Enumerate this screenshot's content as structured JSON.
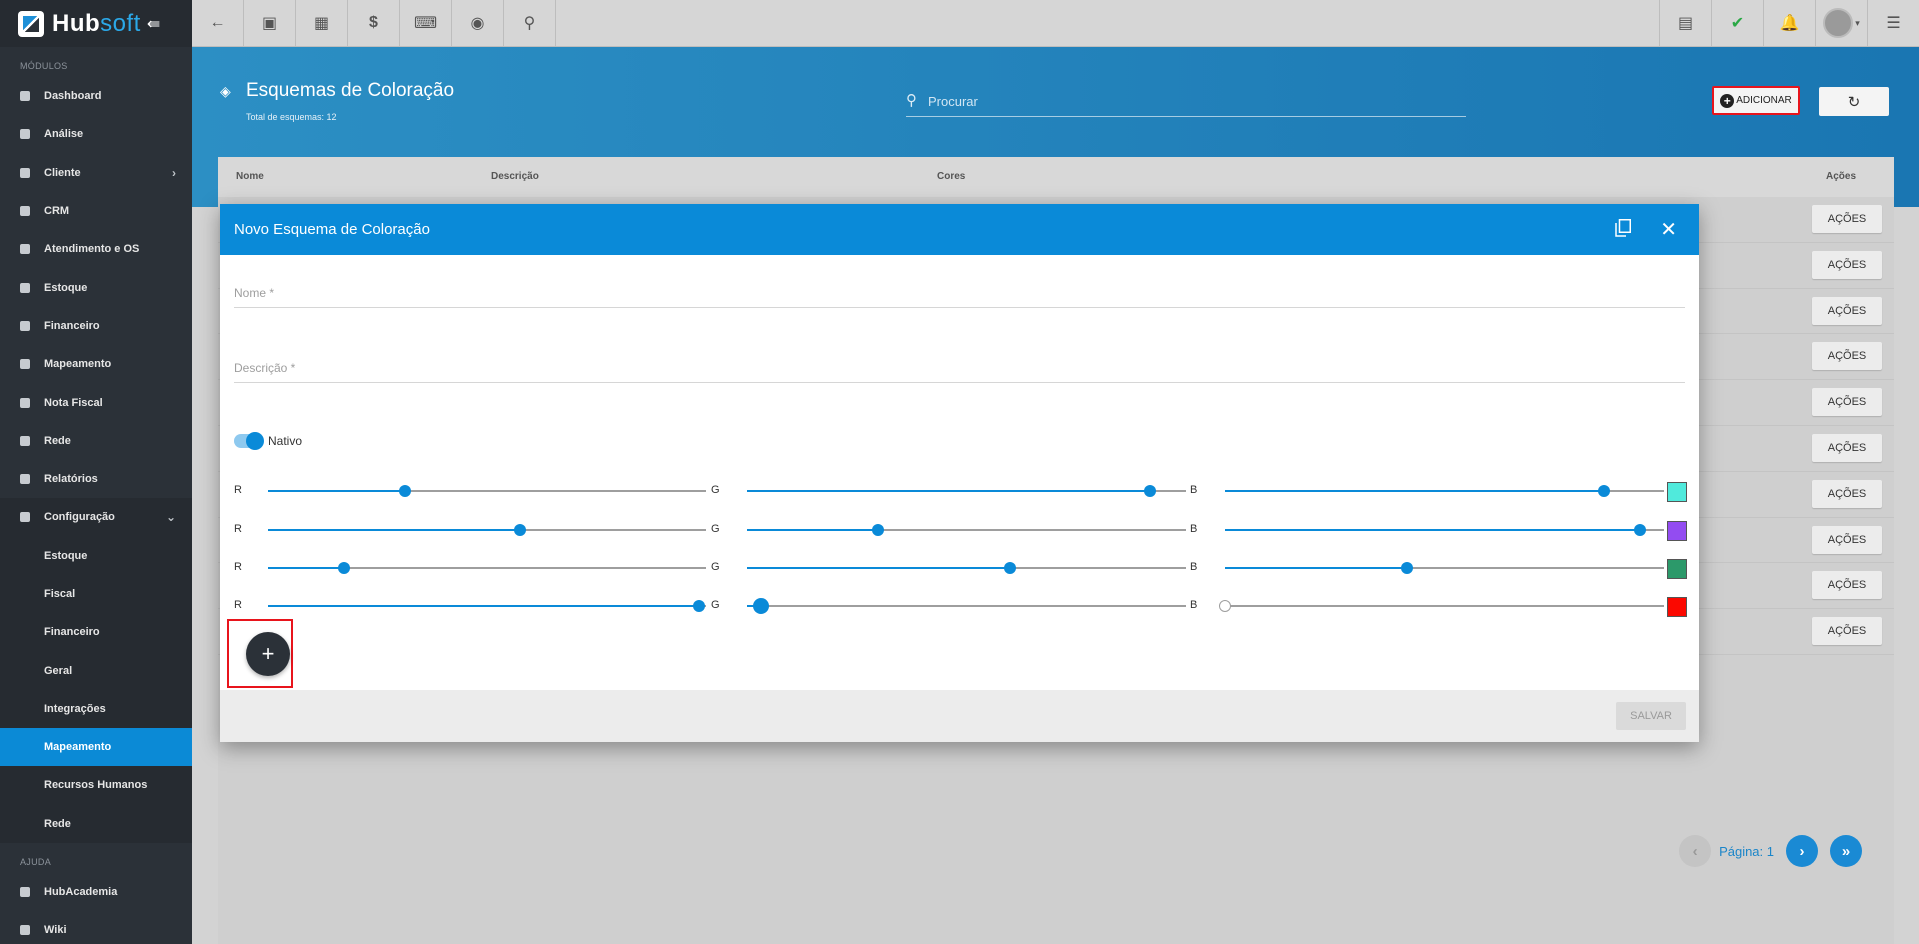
{
  "brand": {
    "name_a": "Hub",
    "name_b": "soft"
  },
  "sidebar": {
    "section_modules": "MÓDULOS",
    "items": [
      {
        "label": "Dashboard"
      },
      {
        "label": "Análise"
      },
      {
        "label": "Cliente"
      },
      {
        "label": "CRM"
      },
      {
        "label": "Atendimento e OS"
      },
      {
        "label": "Estoque"
      },
      {
        "label": "Financeiro"
      },
      {
        "label": "Mapeamento"
      },
      {
        "label": "Nota Fiscal"
      },
      {
        "label": "Rede"
      },
      {
        "label": "Relatórios"
      },
      {
        "label": "Configuração"
      }
    ],
    "sub_items": [
      {
        "label": "Estoque"
      },
      {
        "label": "Fiscal"
      },
      {
        "label": "Financeiro"
      },
      {
        "label": "Geral"
      },
      {
        "label": "Integrações"
      },
      {
        "label": "Mapeamento"
      },
      {
        "label": "Recursos Humanos"
      },
      {
        "label": "Rede"
      }
    ],
    "section_help": "AJUDA",
    "help_items": [
      {
        "label": "HubAcademia"
      },
      {
        "label": "Wiki"
      }
    ]
  },
  "header": {
    "title": "Esquemas de Coloração",
    "subtitle": "Total de esquemas: 12",
    "search_placeholder": "Procurar",
    "add_label": "ADICIONAR"
  },
  "table": {
    "columns": [
      "Nome",
      "Descrição",
      "Cores",
      "Ações"
    ],
    "action_label": "AÇÕES",
    "row_count": 10,
    "page_label": "Página: 1"
  },
  "modal": {
    "title": "Novo Esquema de Coloração",
    "name_placeholder": "Nome *",
    "description_placeholder": "Descrição *",
    "native_label": "Nativo",
    "native_on": true,
    "channel_labels": [
      "R",
      "G",
      "B"
    ],
    "colors": [
      {
        "r": 80,
        "g": 234,
        "b": 220,
        "hex": "#50EADC"
      },
      {
        "r": 147,
        "g": 76,
        "b": 241,
        "hex": "#934CF1"
      },
      {
        "r": 44,
        "g": 153,
        "b": 106,
        "hex": "#2C996A"
      },
      {
        "r": 251,
        "g": 8,
        "b": 0,
        "hex": "#FB0800"
      }
    ],
    "save_label": "SALVAR"
  }
}
